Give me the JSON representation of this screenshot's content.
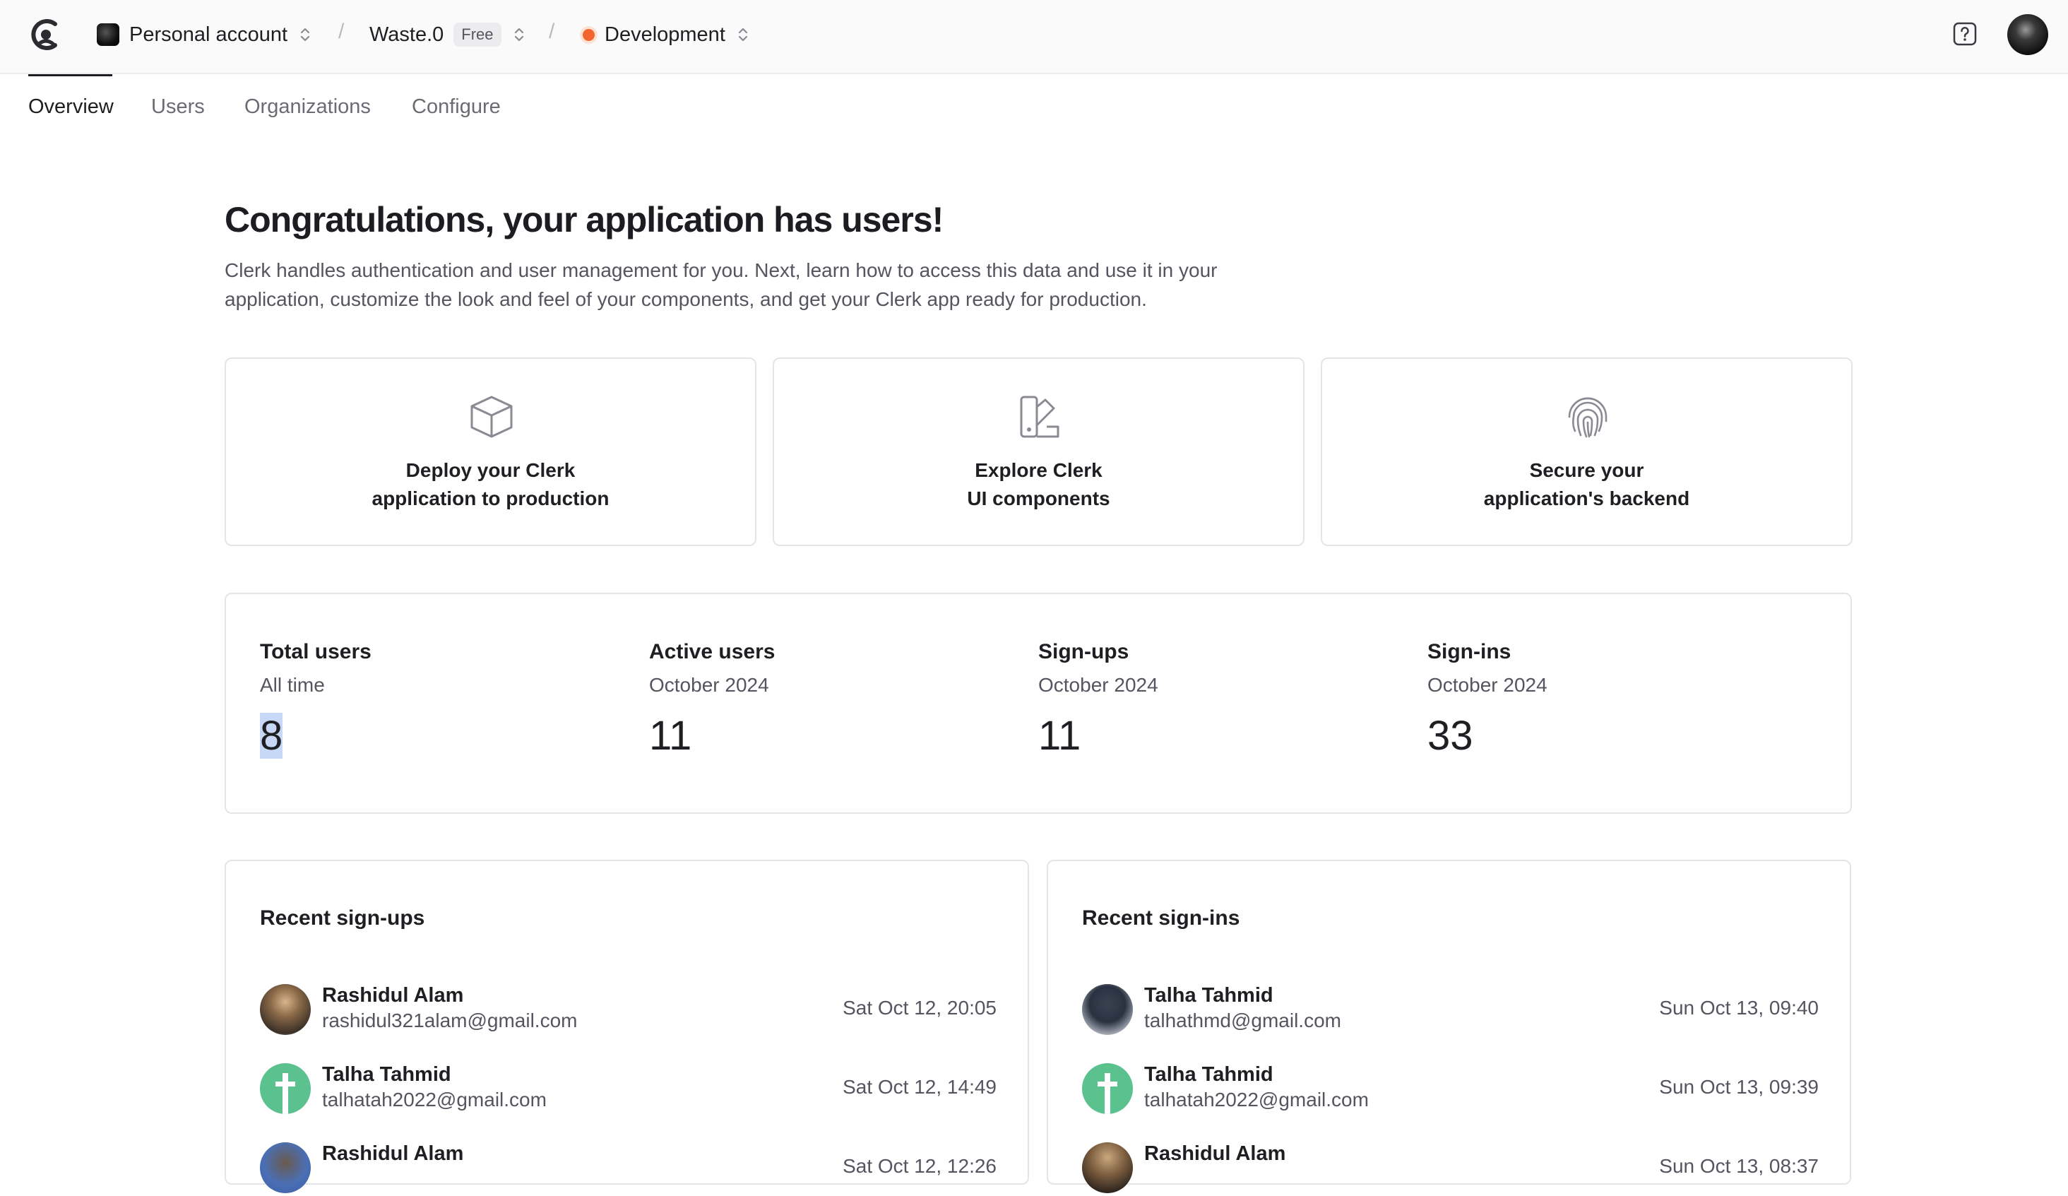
{
  "header": {
    "account_label": "Personal account",
    "app_name": "Waste.0",
    "plan_badge": "Free",
    "environment": "Development",
    "env_dot_color": "#f1662f",
    "help_icon": "help-icon"
  },
  "tabs": [
    {
      "label": "Overview",
      "active": true
    },
    {
      "label": "Users",
      "active": false
    },
    {
      "label": "Organizations",
      "active": false
    },
    {
      "label": "Configure",
      "active": false
    }
  ],
  "hero": {
    "title": "Congratulations, your application has users!",
    "description": "Clerk handles authentication and user management for you. Next, learn how to access this data and use it in your application, customize the look and feel of your components, and get your Clerk app ready for production."
  },
  "action_cards": [
    {
      "line1": "Deploy your Clerk",
      "line2": "application to production",
      "icon": "cube-icon"
    },
    {
      "line1": "Explore Clerk",
      "line2": "UI components",
      "icon": "swatch-icon"
    },
    {
      "line1": "Secure your",
      "line2": "application's backend",
      "icon": "fingerprint-icon"
    }
  ],
  "stats": [
    {
      "title": "Total users",
      "period": "All time",
      "value": "8"
    },
    {
      "title": "Active users",
      "period": "October 2024",
      "value": "11"
    },
    {
      "title": "Sign-ups",
      "period": "October 2024",
      "value": "11"
    },
    {
      "title": "Sign-ins",
      "period": "October 2024",
      "value": "33"
    }
  ],
  "recent_signups": {
    "title": "Recent sign-ups",
    "rows": [
      {
        "name": "Rashidul Alam",
        "email": "rashidul321alam@gmail.com",
        "time": "Sat Oct 12, 20:05"
      },
      {
        "name": "Talha Tahmid",
        "email": "talhatah2022@gmail.com",
        "time": "Sat Oct 12, 14:49"
      },
      {
        "name": "Rashidul Alam",
        "email": "",
        "time": "Sat Oct 12, 12:26"
      }
    ]
  },
  "recent_signins": {
    "title": "Recent sign-ins",
    "rows": [
      {
        "name": "Talha Tahmid",
        "email": "talhathmd@gmail.com",
        "time": "Sun Oct 13, 09:40"
      },
      {
        "name": "Talha Tahmid",
        "email": "talhatah2022@gmail.com",
        "time": "Sun Oct 13, 09:39"
      },
      {
        "name": "Rashidul Alam",
        "email": "",
        "time": "Sun Oct 13, 08:37"
      }
    ]
  }
}
